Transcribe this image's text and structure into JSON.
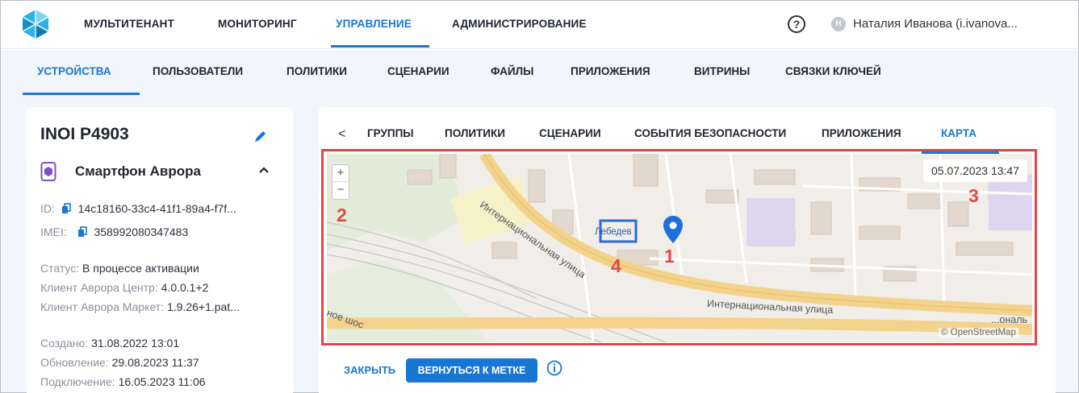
{
  "topnav": {
    "items": [
      "МУЛЬТИТЕНАНТ",
      "МОНИТОРИНГ",
      "УПРАВЛЕНИЕ",
      "АДМИНИСТРИРОВАНИЕ"
    ],
    "active": "УПРАВЛЕНИЕ",
    "help_icon_text": "?",
    "avatar_letter": "Н",
    "username": "Наталия Иванова (i.ivanova..."
  },
  "subnav": {
    "items": [
      "УСТРОЙСТВА",
      "ПОЛЬЗОВАТЕЛИ",
      "ПОЛИТИКИ",
      "СЦЕНАРИИ",
      "ФАЙЛЫ",
      "ПРИЛОЖЕНИЯ",
      "ВИТРИНЫ",
      "СВЯЗКИ КЛЮЧЕЙ"
    ],
    "active": "УСТРОЙСТВА"
  },
  "device": {
    "title": "INOI P4903",
    "type": "Смартфон Аврора",
    "id_label": "ID:",
    "id_value": "14c18160-33c4-41f1-89a4-f7f...",
    "imei_label": "IMEI:",
    "imei_value": "358992080347483",
    "status_label": "Статус:",
    "status_value": "В процессе активации",
    "client_center_label": "Клиент Аврора Центр:",
    "client_center_value": "4.0.0.1+2",
    "client_market_label": "Клиент Аврора Маркет:",
    "client_market_value": "1.9.26+1.pat...",
    "created_label": "Создано:",
    "created_value": "31.08.2022 13:01",
    "updated_label": "Обновление:",
    "updated_value": "29.08.2023 11:37",
    "connected_label": "Подключение:",
    "connected_value": "16.05.2023 11:06"
  },
  "tabs": {
    "back": "<",
    "items": [
      "ГРУППЫ",
      "ПОЛИТИКИ",
      "СЦЕНАРИИ",
      "СОБЫТИЯ БЕЗОПАСНОСТИ",
      "ПРИЛОЖЕНИЯ",
      "КАРТА"
    ],
    "active": "КАРТА"
  },
  "map": {
    "zoom_in": "+",
    "zoom_out": "−",
    "timestamp": "05.07.2023 13:47",
    "station_label": "Лебедев",
    "street_1": "Интернациональная улица",
    "street_2": "Интернациональная улица",
    "street_3": "ное шос",
    "street_4": "...ональ",
    "credit": "© OpenStreetMap",
    "annotations": [
      "1",
      "2",
      "3",
      "4"
    ]
  },
  "actions": {
    "close": "ЗАКРЫТЬ",
    "return": "ВЕРНУТЬСЯ К МЕТКЕ"
  },
  "colors": {
    "accent": "#1976d2",
    "annotation": "#e04848",
    "road": "#f3d38c"
  }
}
